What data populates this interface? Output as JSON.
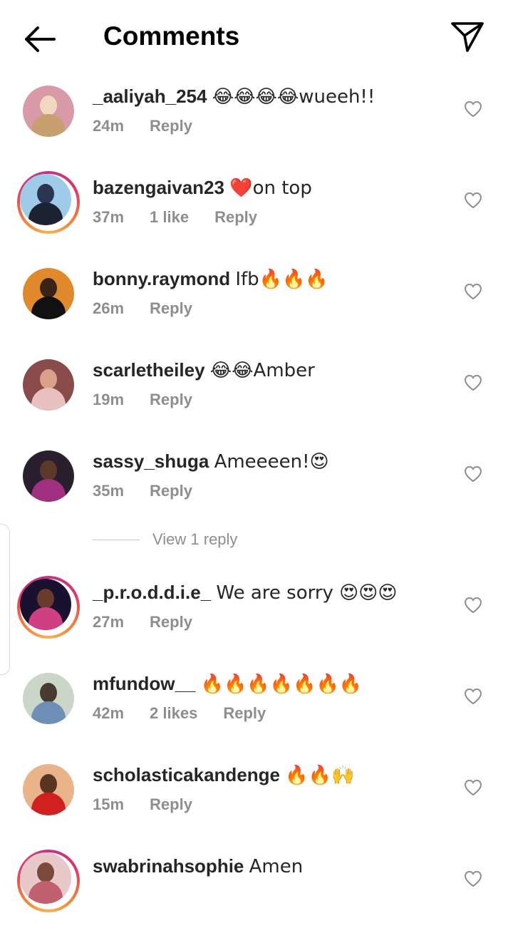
{
  "header": {
    "title": "Comments"
  },
  "comments": [
    {
      "username": "_aaliyah_254",
      "text": "😂😂😂😂wueeh!!",
      "time": "24m",
      "likes": "",
      "reply": "Reply",
      "colors": [
        "#d89aa6",
        "#f0d8c0",
        "#c8a070"
      ]
    },
    {
      "username": "bazengaivan23",
      "text": "❤️on top",
      "time": "37m",
      "likes": "1 like",
      "reply": "Reply",
      "colors": [
        "#9ecbe8",
        "#2a3550",
        "#1b2230"
      ]
    },
    {
      "username": "bonny.raymond",
      "text": "Ifb🔥🔥🔥",
      "time": "26m",
      "likes": "",
      "reply": "Reply",
      "colors": [
        "#e08a2c",
        "#3a2418",
        "#111111"
      ]
    },
    {
      "username": "scarletheiley",
      "text": "😂😂Amber",
      "time": "19m",
      "likes": "",
      "reply": "Reply",
      "colors": [
        "#8a4b4b",
        "#d9a08a",
        "#e9c0c0"
      ]
    },
    {
      "username": "sassy_shuga",
      "text": "Ameeeen!😍",
      "time": "35m",
      "likes": "",
      "reply": "Reply",
      "colors": [
        "#2a1f2f",
        "#5b3a2a",
        "#a03080"
      ]
    },
    {
      "username": "_p.r.o.d.d.i.e_",
      "text": "We are sorry 😍😍😍",
      "time": "27m",
      "likes": "",
      "reply": "Reply",
      "colors": [
        "#1a1030",
        "#6a3a2a",
        "#d04080"
      ]
    },
    {
      "username": "mfundow__",
      "text": "🔥🔥🔥🔥🔥🔥🔥",
      "time": "42m",
      "likes": "2 likes",
      "reply": "Reply",
      "colors": [
        "#c9d6c8",
        "#4a3a30",
        "#6f8fb8"
      ]
    },
    {
      "username": "scholasticakandenge",
      "text": "🔥🔥🙌",
      "time": "15m",
      "likes": "",
      "reply": "Reply",
      "colors": [
        "#e9b48a",
        "#5a3520",
        "#d02020"
      ]
    },
    {
      "username": "swabrinahsophie",
      "text": "Amen",
      "time": "",
      "likes": "",
      "reply": "",
      "colors": [
        "#e8c8c8",
        "#7a4a3a",
        "#c06070"
      ]
    }
  ],
  "view_replies_label": "View 1 reply",
  "icons": {
    "back": "arrow-left-icon",
    "send": "paper-plane-icon",
    "like": "heart-outline-icon"
  }
}
